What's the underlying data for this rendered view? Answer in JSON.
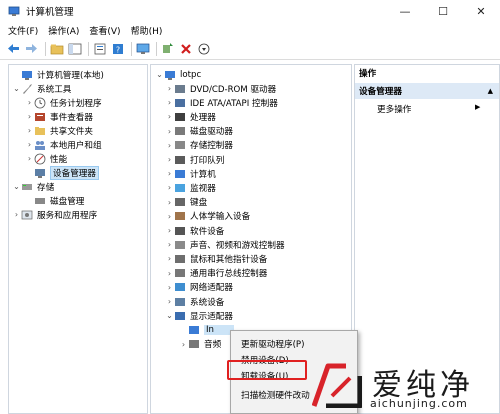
{
  "window": {
    "title": "计算机管理",
    "controls": {
      "minimize": "—",
      "maximize": "☐",
      "close": "✕"
    }
  },
  "menubar": [
    "文件(F)",
    "操作(A)",
    "查看(V)",
    "帮助(H)"
  ],
  "left_tree": [
    {
      "label": "计算机管理(本地)",
      "icon": "computer-management-icon"
    },
    {
      "label": "系统工具",
      "icon": "tools-icon"
    },
    {
      "label": "任务计划程序",
      "icon": "clock-icon"
    },
    {
      "label": "事件查看器",
      "icon": "event-viewer-icon"
    },
    {
      "label": "共享文件夹",
      "icon": "shared-folder-icon"
    },
    {
      "label": "本地用户和组",
      "icon": "users-icon"
    },
    {
      "label": "性能",
      "icon": "performance-icon"
    },
    {
      "label": "设备管理器",
      "icon": "device-manager-icon"
    },
    {
      "label": "存储",
      "icon": "storage-icon"
    },
    {
      "label": "磁盘管理",
      "icon": "disk-icon"
    },
    {
      "label": "服务和应用程序",
      "icon": "services-icon"
    }
  ],
  "device_tree": {
    "root": "lotpc",
    "items": [
      "DVD/CD-ROM 驱动器",
      "IDE ATA/ATAPI 控制器",
      "处理器",
      "磁盘驱动器",
      "存储控制器",
      "打印队列",
      "计算机",
      "监视器",
      "键盘",
      "人体学输入设备",
      "软件设备",
      "声音、视频和游戏控制器",
      "鼠标和其他指针设备",
      "通用串行总线控制器",
      "网络适配器",
      "系统设备",
      "显示适配器",
      "In",
      "音频"
    ]
  },
  "actions": {
    "header": "操作",
    "section": "设备管理器",
    "more": "更多操作"
  },
  "context_menu": [
    "更新驱动程序(P)",
    "禁用设备(D)",
    "卸载设备(U)",
    "扫描检测硬件改动"
  ],
  "watermark": {
    "name": "爱纯净",
    "url": "aichunjing.com"
  },
  "colors": {
    "selection": "#cce4f7",
    "actions_section": "#dde9f6",
    "highlight_border": "#e02020"
  }
}
